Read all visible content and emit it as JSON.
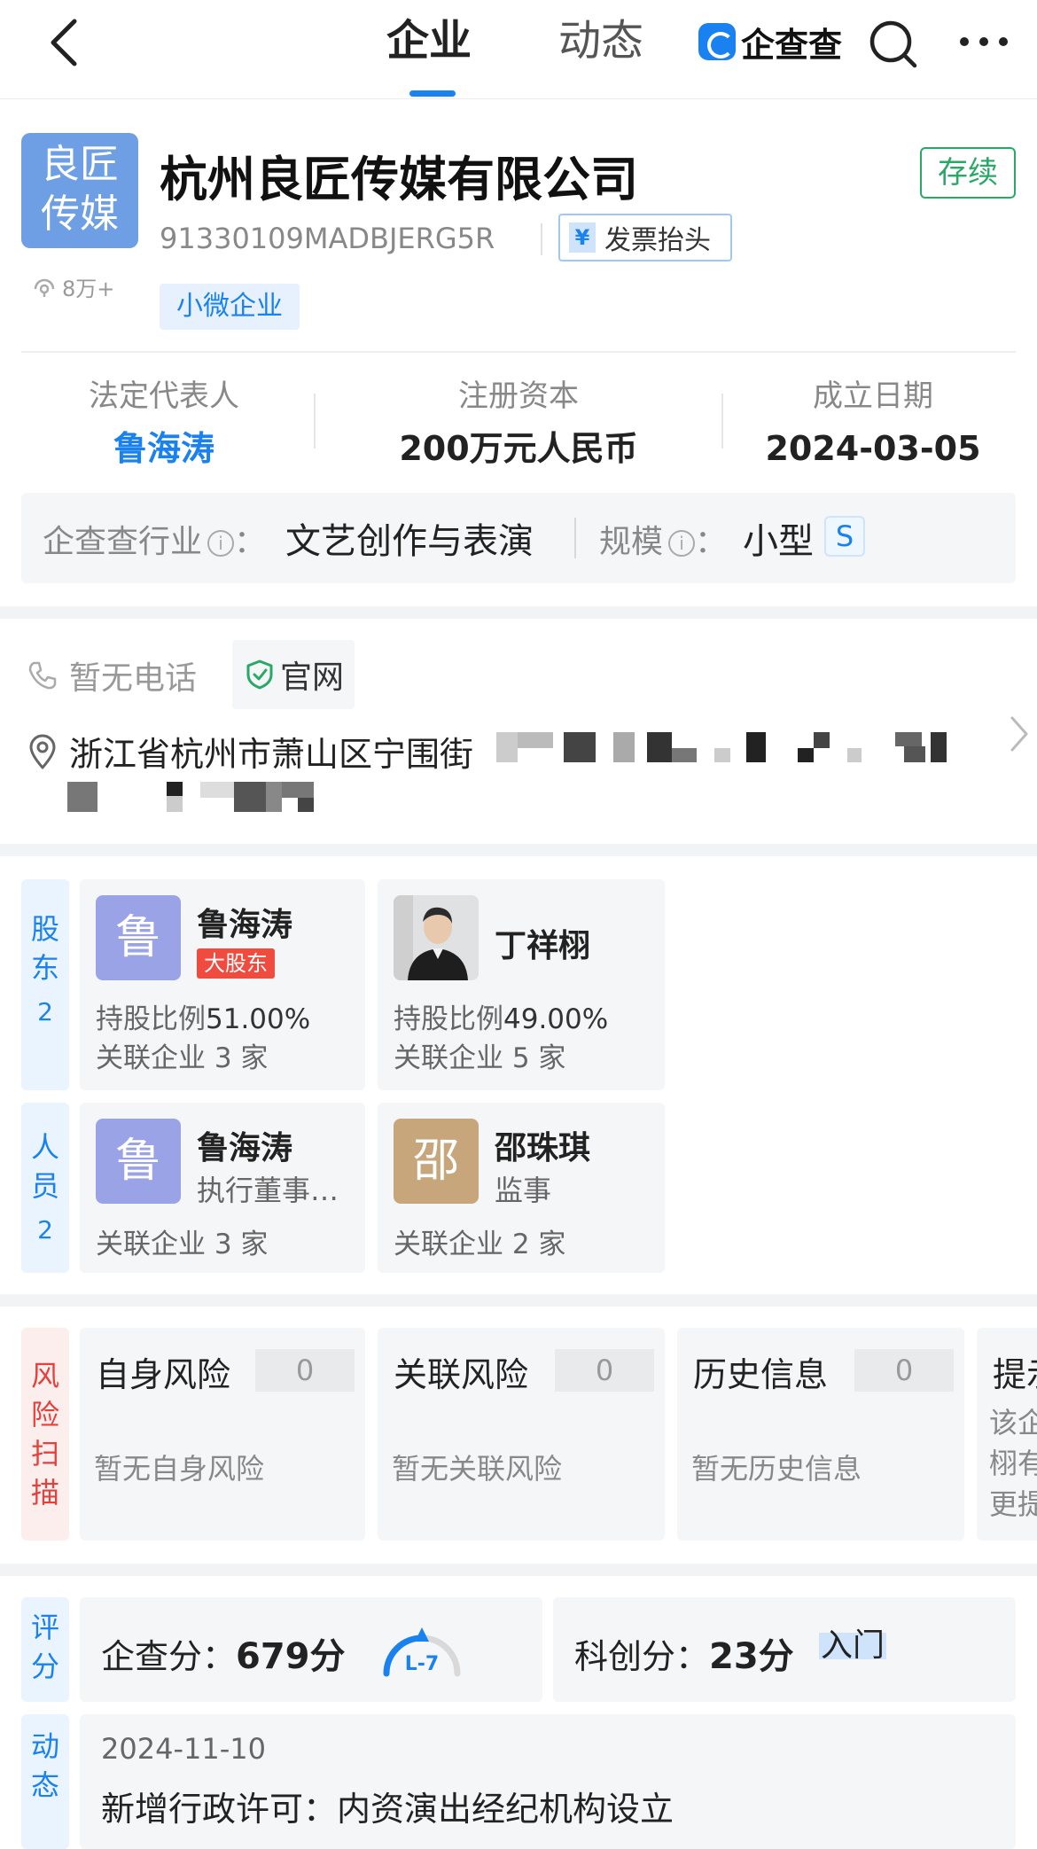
{
  "nav": {
    "tab_active": "企业",
    "tab_inactive": "动态",
    "brand": "企查查"
  },
  "company": {
    "logo_line1": "良匠",
    "logo_line2": "传媒",
    "views": "8万+",
    "name": "杭州良匠传媒有限公司",
    "status": "存续",
    "credit_code": "91330109MADBJERG5R",
    "invoice_label": "发票抬头",
    "invoice_icon": "¥",
    "tag": "小微企业"
  },
  "key_info": {
    "legal_rep_label": "法定代表人",
    "legal_rep_value": "鲁海涛",
    "capital_label": "注册资本",
    "capital_value": "200万元人民币",
    "date_label": "成立日期",
    "date_value": "2024-03-05"
  },
  "industry": {
    "label": "企查查行业",
    "colon": "：",
    "value": "文艺创作与表演",
    "scale_label": "规模",
    "scale_value": "小型",
    "scale_badge": "S",
    "info_glyph": "i"
  },
  "contact": {
    "phone": "暂无电话",
    "website": "官网",
    "address": "浙江省杭州市萧山区宁围街"
  },
  "shareholders": {
    "tab": [
      "股",
      "东"
    ],
    "count": "2",
    "items": [
      {
        "avatar": "鲁",
        "name": "鲁海涛",
        "badge": "大股东",
        "ratio_label": "持股比例",
        "ratio": "51.00%",
        "related": "关联企业 3 家"
      },
      {
        "name": "丁祥栩",
        "ratio_label": "持股比例",
        "ratio": "49.00%",
        "related": "关联企业 5 家"
      }
    ]
  },
  "personnel": {
    "tab": [
      "人",
      "员"
    ],
    "count": "2",
    "items": [
      {
        "avatar": "鲁",
        "name": "鲁海涛",
        "role": "执行董事…",
        "related": "关联企业 3 家"
      },
      {
        "avatar": "邵",
        "name": "邵珠琪",
        "role": "监事",
        "related": "关联企业 2 家"
      }
    ]
  },
  "risk": {
    "tab": [
      "风",
      "险",
      "扫",
      "描"
    ],
    "cards": [
      {
        "title": "自身风险",
        "count": "0",
        "desc": "暂无自身风险"
      },
      {
        "title": "关联风险",
        "count": "0",
        "desc": "暂无关联风险"
      },
      {
        "title": "历史信息",
        "count": "0",
        "desc": "暂无历史信息"
      }
    ],
    "partial": {
      "title": "提示",
      "lines": [
        "该企",
        "栩有",
        "更提"
      ]
    }
  },
  "score": {
    "tab": [
      "评",
      "分"
    ],
    "qcc_label": "企查分：",
    "qcc_value": "679分",
    "gauge_label": "L-7",
    "kc_label": "科创分：",
    "kc_value": "23分",
    "kc_level": "入门"
  },
  "dynamics": {
    "tab": [
      "动",
      "态"
    ],
    "date": "2024-11-10",
    "text": "新增行政许可：内资演出经纪机构设立"
  },
  "colors": {
    "brand_blue": "#1a82f0",
    "status_green": "#2aa867",
    "badge_red": "#ef4b3f",
    "risk_red": "#e2413c"
  }
}
